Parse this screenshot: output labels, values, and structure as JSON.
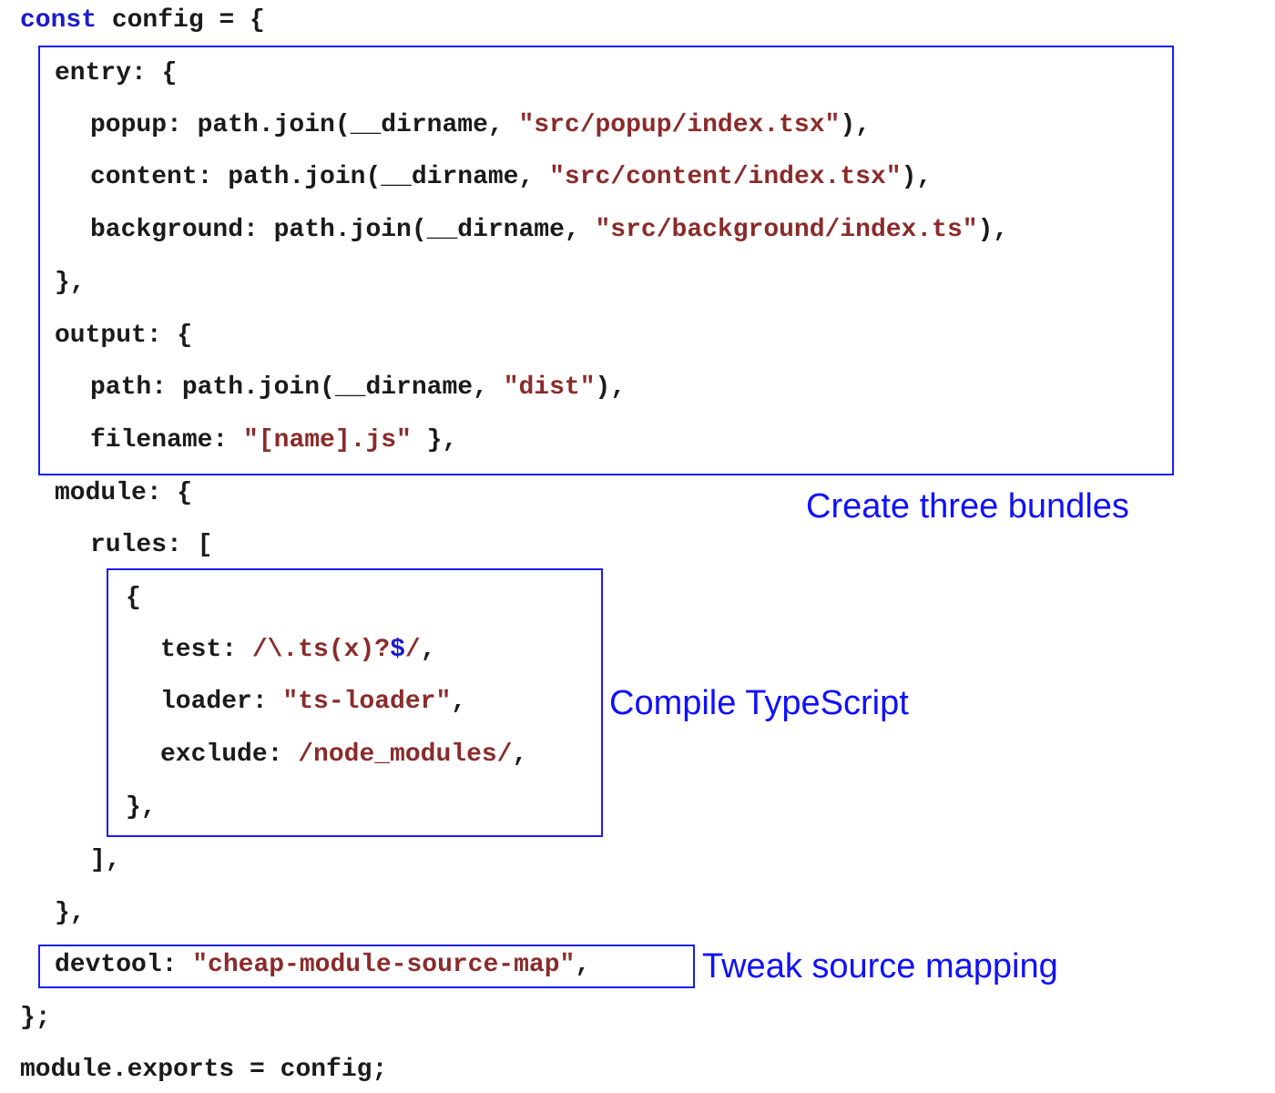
{
  "code": {
    "l01": {
      "kw": "const",
      "rest": " config = {"
    },
    "l02": "entry: {",
    "l03": {
      "pre": "popup: path.join(__dirname, ",
      "str": "\"src/popup/index.tsx\"",
      "post": "),"
    },
    "l04": {
      "pre": "content: path.join(__dirname, ",
      "str": "\"src/content/index.tsx\"",
      "post": "),"
    },
    "l05": {
      "pre": "background: path.join(__dirname, ",
      "str": "\"src/background/index.ts\"",
      "post": "),"
    },
    "l06": "},",
    "l07": "output: {",
    "l08": {
      "pre": "path: path.join(__dirname, ",
      "str": "\"dist\"",
      "post": "),"
    },
    "l09": {
      "pre": "filename: ",
      "str": "\"[name].js\"",
      "post": " },"
    },
    "l10": "module: {",
    "l11": "rules: [",
    "l12": "{",
    "l13": {
      "pre": "test: ",
      "str": "/\\.ts(x)?",
      "end": "$",
      "str2": "/",
      "post": ","
    },
    "l14": {
      "pre": "loader: ",
      "str": "\"ts-loader\"",
      "post": ","
    },
    "l15": {
      "pre": "exclude: ",
      "str": "/node_modules/",
      "post": ","
    },
    "l16": "},",
    "l17": "],",
    "l18": "},",
    "l19": {
      "pre": "devtool: ",
      "str": "\"cheap-module-source-map\"",
      "post": ","
    },
    "l20": "};",
    "l21": "module.exports = config;"
  },
  "annotations": {
    "bundles": "Create three bundles",
    "typescript": "Compile TypeScript",
    "sourcemap": "Tweak source mapping"
  },
  "colors": {
    "keyword": "#1a1acc",
    "string": "#8b2a2a",
    "annotation": "#1010ff",
    "box_border": "#1a1aff"
  }
}
